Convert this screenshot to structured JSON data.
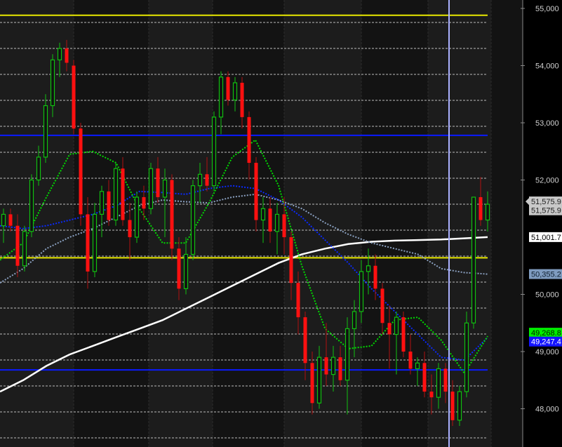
{
  "chart_data": {
    "type": "candlestick",
    "title": "",
    "ylim": [
      47450,
      55150
    ],
    "y_ticks": [
      "55,000",
      "54,000",
      "53,000",
      "52,000",
      "50,000",
      "49,000",
      "48,000"
    ],
    "y_tick_values": [
      55000,
      54000,
      53000,
      52000,
      50000,
      49000,
      48000
    ],
    "grid": true,
    "candles": [
      [
        51200,
        51500,
        50900,
        51400
      ],
      [
        51400,
        51500,
        51100,
        51200
      ],
      [
        51200,
        51400,
        50300,
        50500
      ],
      [
        50500,
        51200,
        50400,
        51100
      ],
      [
        51100,
        52100,
        51000,
        52000
      ],
      [
        52000,
        52600,
        51900,
        52400
      ],
      [
        52400,
        53500,
        52300,
        53300
      ],
      [
        53300,
        54200,
        53100,
        54100
      ],
      [
        54100,
        54400,
        53800,
        54300
      ],
      [
        54300,
        54450,
        53900,
        54050
      ],
      [
        54000,
        54100,
        52800,
        52900
      ],
      [
        52900,
        53000,
        51200,
        51400
      ],
      [
        51400,
        51700,
        50100,
        50400
      ],
      [
        50400,
        51600,
        50300,
        51400
      ],
      [
        51400,
        51900,
        51000,
        51800
      ],
      [
        51800,
        52000,
        51200,
        51300
      ],
      [
        51300,
        52300,
        51200,
        52200
      ],
      [
        52200,
        52400,
        51200,
        51300
      ],
      [
        51300,
        51600,
        50600,
        51000
      ],
      [
        51000,
        51800,
        50900,
        51700
      ],
      [
        51700,
        51900,
        51300,
        51500
      ],
      [
        51500,
        52300,
        51400,
        52200
      ],
      [
        52200,
        52400,
        51600,
        51700
      ],
      [
        51700,
        52200,
        51000,
        52000
      ],
      [
        52000,
        52100,
        50600,
        50800
      ],
      [
        50800,
        51000,
        49900,
        50100
      ],
      [
        50100,
        51000,
        50000,
        50700
      ],
      [
        50700,
        52000,
        50600,
        51900
      ],
      [
        51900,
        52300,
        51600,
        52100
      ],
      [
        52100,
        52400,
        51800,
        51900
      ],
      [
        51900,
        53200,
        51800,
        53100
      ],
      [
        53100,
        53900,
        52800,
        53800
      ],
      [
        53800,
        53900,
        53300,
        53400
      ],
      [
        53400,
        53800,
        53200,
        53700
      ],
      [
        53700,
        53800,
        52900,
        53100
      ],
      [
        53100,
        53200,
        52000,
        52300
      ],
      [
        52300,
        52400,
        51100,
        51300
      ],
      [
        51300,
        51700,
        50900,
        51500
      ],
      [
        51500,
        51700,
        50900,
        51100
      ],
      [
        51100,
        51600,
        50700,
        51400
      ],
      [
        51400,
        51700,
        50700,
        51000
      ],
      [
        51000,
        51100,
        49900,
        50200
      ],
      [
        50200,
        50400,
        49300,
        49600
      ],
      [
        49600,
        49700,
        48500,
        48800
      ],
      [
        48800,
        49000,
        47900,
        48100
      ],
      [
        48100,
        49100,
        48000,
        48900
      ],
      [
        48900,
        49500,
        48400,
        48600
      ],
      [
        48600,
        49100,
        48300,
        48900
      ],
      [
        48900,
        49100,
        48400,
        48500
      ],
      [
        48500,
        49600,
        47900,
        49400
      ],
      [
        49400,
        49900,
        48900,
        49700
      ],
      [
        49700,
        50600,
        49500,
        50400
      ],
      [
        50400,
        50800,
        50000,
        50500
      ],
      [
        50500,
        50700,
        49900,
        50100
      ],
      [
        50100,
        50200,
        49300,
        49500
      ],
      [
        49500,
        49800,
        48700,
        49300
      ],
      [
        49300,
        49700,
        48600,
        49600
      ],
      [
        49600,
        49700,
        48900,
        49000
      ],
      [
        49000,
        49300,
        48600,
        48700
      ],
      [
        48700,
        48900,
        48400,
        48800
      ],
      [
        48800,
        49000,
        48200,
        48300
      ],
      [
        48300,
        48600,
        47900,
        48200
      ],
      [
        48200,
        48800,
        48000,
        48700
      ],
      [
        48700,
        48800,
        48100,
        48300
      ],
      [
        48300,
        48500,
        47700,
        47800
      ],
      [
        47800,
        48400,
        47700,
        48300
      ],
      [
        48300,
        49700,
        48200,
        49500
      ],
      [
        49500,
        51700,
        49400,
        51700
      ],
      [
        51700,
        52050,
        51200,
        51300
      ],
      [
        51300,
        51800,
        51100,
        51576
      ]
    ],
    "moving_averages": [
      {
        "name": "MA white",
        "color": "#ffffff",
        "dotted": false,
        "values": [
          48300,
          48500,
          48750,
          48950,
          49100,
          49250,
          49400,
          49550,
          49750,
          49950,
          50150,
          50350,
          50550,
          50700,
          50800,
          50880,
          50920,
          50940,
          50950,
          50960,
          50980,
          51001.7
        ]
      },
      {
        "name": "MA blue",
        "color": "#0a2aff",
        "dotted": true,
        "values": [
          51200,
          51150,
          51200,
          51300,
          51400,
          51550,
          51800,
          51780,
          51750,
          51850,
          51900,
          51850,
          51650,
          51350,
          50950,
          50550,
          50100,
          49700,
          49300,
          48900,
          48850,
          49247.4
        ]
      },
      {
        "name": "MA steel",
        "color": "#8aa0c0",
        "dotted": true,
        "values": [
          50200,
          50450,
          50800,
          51000,
          51150,
          51350,
          51550,
          51650,
          51620,
          51600,
          51700,
          51750,
          51650,
          51500,
          51250,
          51050,
          50900,
          50800,
          50700,
          50450,
          50380,
          50355.2
        ]
      },
      {
        "name": "MA green",
        "color": "#00dd00",
        "dotted": true,
        "values": [
          50600,
          50900,
          51700,
          52450,
          52500,
          52300,
          51500,
          50900,
          50900,
          51600,
          52400,
          52700,
          51900,
          50500,
          49400,
          49050,
          49100,
          49550,
          49600,
          49200,
          48620,
          49268.8
        ]
      }
    ],
    "horizontal_lines": [
      {
        "price": 54880,
        "color": "#e8e800"
      },
      {
        "price": 52780,
        "color": "#0a1aff"
      },
      {
        "price": 50640,
        "color": "#e8e800"
      },
      {
        "price": 48680,
        "color": "#0a1aff"
      }
    ],
    "price_badges": [
      {
        "text": "51,575.9",
        "bg": "#c8c8c8",
        "fg": "#202020",
        "price": 51625,
        "arrow": true
      },
      {
        "text": "51,575.9",
        "bg": "#c8c8c8",
        "fg": "#202020",
        "price": 51470,
        "arrow": false
      },
      {
        "text": "51,001.7",
        "bg": "#ffffff",
        "fg": "#000000",
        "price": 51001.7,
        "arrow": false
      },
      {
        "text": "50,355.2",
        "bg": "#7f9cc0",
        "fg": "#102030",
        "price": 50355.2,
        "arrow": false
      },
      {
        "text": "49,268.8",
        "bg": "#00ee00",
        "fg": "#002000",
        "price": 49330,
        "arrow": false
      },
      {
        "text": "49,247.4",
        "bg": "#1414ff",
        "fg": "#ffffff",
        "price": 49175,
        "arrow": false
      }
    ],
    "colors": {
      "up": "#10c010",
      "down": "#ff1010",
      "cursor": "#aab0ff"
    }
  }
}
